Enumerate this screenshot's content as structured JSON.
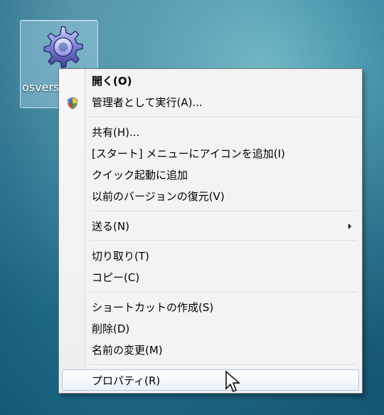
{
  "desktop": {
    "icon_label": "osvers e",
    "colors": {
      "bg_top": "#6fb7c5",
      "bg_bottom": "#145a76"
    }
  },
  "context_menu": {
    "items": [
      {
        "label": "開く(O)",
        "bold": true,
        "icon": "none"
      },
      {
        "label": "管理者として実行(A)...",
        "icon": "uac-shield-icon"
      },
      {
        "label": "共有(H)..."
      },
      {
        "label": "[スタート] メニューにアイコンを追加(I)"
      },
      {
        "label": "クイック起動に追加"
      },
      {
        "label": "以前のバージョンの復元(V)"
      },
      {
        "label": "送る(N)",
        "has_submenu": true
      },
      {
        "label": "切り取り(T)"
      },
      {
        "label": "コピー(C)"
      },
      {
        "label": "ショートカットの作成(S)"
      },
      {
        "label": "削除(D)"
      },
      {
        "label": "名前の変更(M)"
      },
      {
        "label": "プロパティ(R)",
        "highlighted": true
      }
    ]
  }
}
